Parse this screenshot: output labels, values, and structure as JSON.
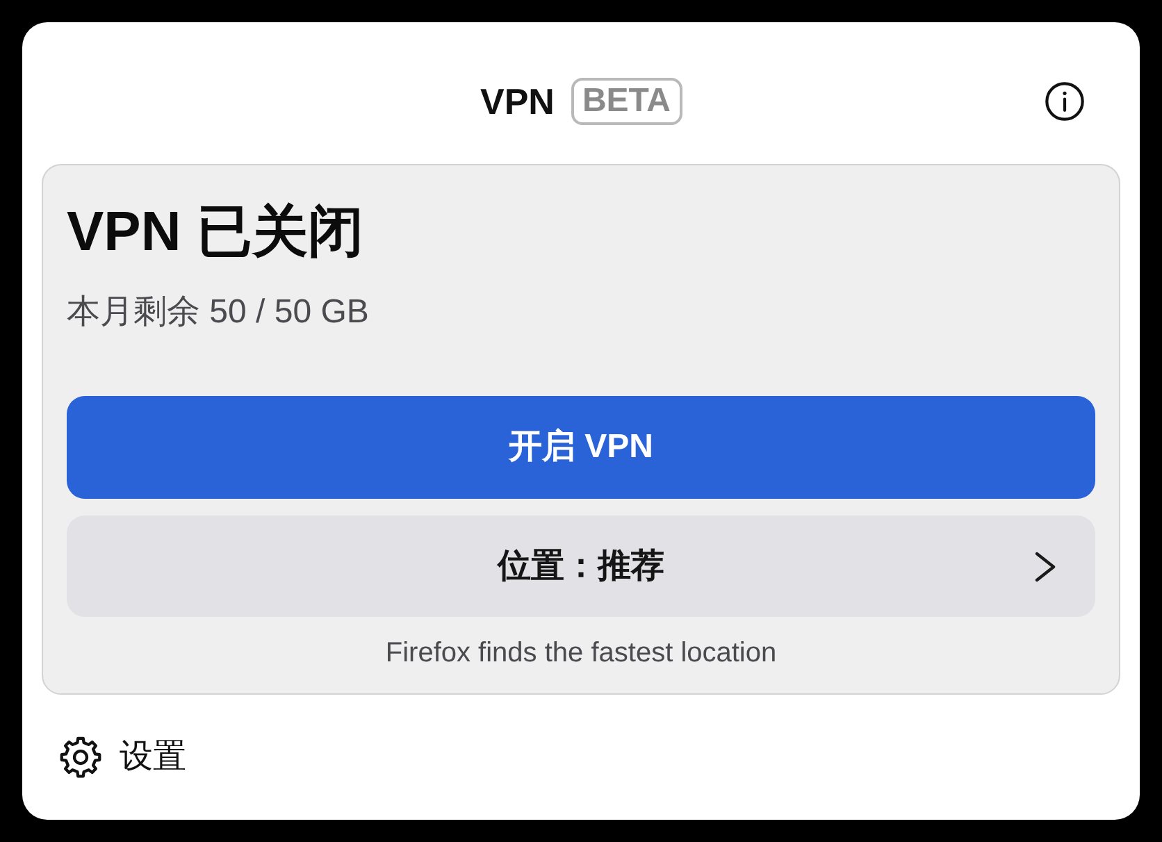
{
  "header": {
    "title": "VPN",
    "badge": "BETA"
  },
  "status": {
    "title": "VPN 已关闭",
    "usage": "本月剩余 50 / 50 GB"
  },
  "toggle_button": {
    "label": "开启 VPN"
  },
  "location": {
    "label": "位置：推荐",
    "hint": "Firefox finds the fastest location"
  },
  "footer": {
    "settings": "设置"
  }
}
